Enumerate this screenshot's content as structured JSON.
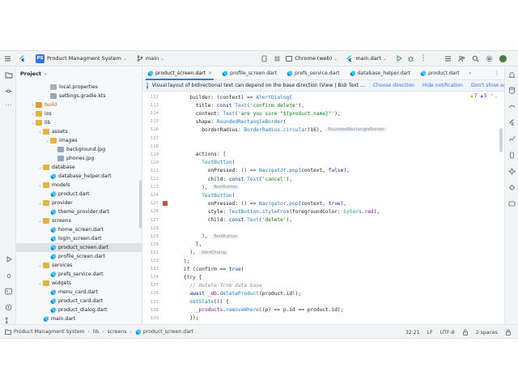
{
  "titlebar": {
    "project_badge": "PS",
    "project_name": "Product Managment System",
    "branch": "main",
    "device": "Chrome (web)",
    "run_config": "main.dart"
  },
  "project_panel": {
    "title": "Project",
    "tree": [
      {
        "label": "local.properties",
        "depth": 3,
        "kind": "prop",
        "expanded": null,
        "selected": false
      },
      {
        "label": "settings.gradle.kts",
        "depth": 3,
        "kind": "kts",
        "expanded": null,
        "selected": false
      },
      {
        "label": "build",
        "depth": 1,
        "kind": "folder-orange",
        "expanded": false,
        "selected": false
      },
      {
        "label": "ios",
        "depth": 1,
        "kind": "folder",
        "expanded": false,
        "selected": false
      },
      {
        "label": "lib",
        "depth": 1,
        "kind": "folder",
        "expanded": true,
        "selected": false
      },
      {
        "label": "assets",
        "depth": 2,
        "kind": "folder",
        "expanded": true,
        "selected": false
      },
      {
        "label": "images",
        "depth": 3,
        "kind": "folder",
        "expanded": true,
        "selected": false
      },
      {
        "label": "background.jpg",
        "depth": 4,
        "kind": "img",
        "expanded": null,
        "selected": false
      },
      {
        "label": "phones.jpg",
        "depth": 4,
        "kind": "img",
        "expanded": null,
        "selected": false
      },
      {
        "label": "database",
        "depth": 2,
        "kind": "folder",
        "expanded": true,
        "selected": false
      },
      {
        "label": "database_helper.dart",
        "depth": 3,
        "kind": "dart",
        "expanded": null,
        "selected": false
      },
      {
        "label": "models",
        "depth": 2,
        "kind": "folder",
        "expanded": true,
        "selected": false
      },
      {
        "label": "product.dart",
        "depth": 3,
        "kind": "dart",
        "expanded": null,
        "selected": false
      },
      {
        "label": "provider",
        "depth": 2,
        "kind": "folder",
        "expanded": true,
        "selected": false
      },
      {
        "label": "theme_provider.dart",
        "depth": 3,
        "kind": "dart",
        "expanded": null,
        "selected": false
      },
      {
        "label": "screens",
        "depth": 2,
        "kind": "folder",
        "expanded": true,
        "selected": false
      },
      {
        "label": "home_screen.dart",
        "depth": 3,
        "kind": "dart",
        "expanded": null,
        "selected": false
      },
      {
        "label": "login_screen.dart",
        "depth": 3,
        "kind": "dart",
        "expanded": null,
        "selected": false
      },
      {
        "label": "product_screen.dart",
        "depth": 3,
        "kind": "dart",
        "expanded": null,
        "selected": true
      },
      {
        "label": "profile_screen.dart",
        "depth": 3,
        "kind": "dart",
        "expanded": null,
        "selected": false
      },
      {
        "label": "services",
        "depth": 2,
        "kind": "folder",
        "expanded": true,
        "selected": false
      },
      {
        "label": "prefs_service.dart",
        "depth": 3,
        "kind": "dart",
        "expanded": null,
        "selected": false
      },
      {
        "label": "widgets",
        "depth": 2,
        "kind": "folder",
        "expanded": true,
        "selected": false
      },
      {
        "label": "menu_card.dart",
        "depth": 3,
        "kind": "dart",
        "expanded": null,
        "selected": false
      },
      {
        "label": "product_card.dart",
        "depth": 3,
        "kind": "dart",
        "expanded": null,
        "selected": false
      },
      {
        "label": "product_dialog.dart",
        "depth": 3,
        "kind": "dart",
        "expanded": null,
        "selected": false
      },
      {
        "label": "main.dart",
        "depth": 2,
        "kind": "dart",
        "expanded": null,
        "selected": false
      }
    ]
  },
  "editor": {
    "tabs": [
      {
        "label": "product_screen.dart",
        "active": true,
        "closable": true
      },
      {
        "label": "profile_screen.dart",
        "active": false,
        "closable": false
      },
      {
        "label": "prefs_service.dart",
        "active": false,
        "closable": false
      },
      {
        "label": "database_helper.dart",
        "active": false,
        "closable": false
      },
      {
        "label": "product.dart",
        "active": false,
        "closable": false
      }
    ],
    "banner": {
      "message": "Visual layout of bidirectional text can depend on the base direction (View | Bidi Text ...",
      "choose_direction": "Choose direction",
      "hide_notification": "Hide notification",
      "dont_show_again": "Don't show again"
    },
    "inspections": {
      "warnings": "7",
      "weak_warnings": "5"
    },
    "lines": [
      {
        "n": "112",
        "tokens": [
          [
            "t",
            "      builder: (context) => "
          ],
          [
            "cl",
            "AlertDialog"
          ],
          [
            "t",
            "("
          ]
        ]
      },
      {
        "n": "113",
        "tokens": [
          [
            "t",
            "        title: "
          ],
          [
            "k",
            "const "
          ],
          [
            "cl",
            "Text"
          ],
          [
            "t",
            "("
          ],
          [
            "s",
            "'confirm delete'"
          ],
          [
            "t",
            "),"
          ]
        ]
      },
      {
        "n": "114",
        "tokens": [
          [
            "t",
            "        content: "
          ],
          [
            "cl",
            "Text"
          ],
          [
            "t",
            "("
          ],
          [
            "s",
            "'are you sure \"${product.name}\"'"
          ],
          [
            "t",
            "),"
          ]
        ]
      },
      {
        "n": "115",
        "tokens": [
          [
            "t",
            "        shape: "
          ],
          [
            "cl",
            "RoundedRectangleBorder"
          ],
          [
            "t",
            "("
          ]
        ]
      },
      {
        "n": "116",
        "tokens": [
          [
            "t",
            "          borderRadius: "
          ],
          [
            "cl",
            "BorderRadius"
          ],
          [
            "t",
            "."
          ],
          [
            "cl",
            "circular"
          ],
          [
            "t",
            "(16),"
          ]
        ],
        "hint": "RoundedRectangleBorder"
      },
      {
        "n": "117",
        "tokens": [
          [
            "t",
            ""
          ]
        ]
      },
      {
        "n": "118",
        "tokens": [
          [
            "t",
            ""
          ]
        ]
      },
      {
        "n": "119",
        "tokens": [
          [
            "t",
            "        actions: ["
          ]
        ]
      },
      {
        "n": "120",
        "tokens": [
          [
            "t",
            "          "
          ],
          [
            "cl",
            "TextButton"
          ],
          [
            "t",
            "("
          ]
        ]
      },
      {
        "n": "121",
        "tokens": [
          [
            "t",
            "            onPressed: () => "
          ],
          [
            "cl",
            "Navigator"
          ],
          [
            "t",
            "."
          ],
          [
            "cl",
            "pop"
          ],
          [
            "t",
            "(context, "
          ],
          [
            "k",
            "false"
          ],
          [
            "t",
            "),"
          ]
        ]
      },
      {
        "n": "122",
        "tokens": [
          [
            "t",
            "            child: "
          ],
          [
            "k",
            "const "
          ],
          [
            "cl",
            "Text"
          ],
          [
            "t",
            "("
          ],
          [
            "s",
            "'cancel'"
          ],
          [
            "t",
            "),"
          ]
        ]
      },
      {
        "n": "123",
        "tokens": [
          [
            "t",
            "          ),"
          ]
        ],
        "hint": "TextButton"
      },
      {
        "n": "124",
        "tokens": [
          [
            "t",
            "          "
          ],
          [
            "cl",
            "TextButton"
          ],
          [
            "t",
            "("
          ]
        ]
      },
      {
        "n": "125",
        "tokens": [
          [
            "t",
            "            onPressed: () => "
          ],
          [
            "cl",
            "Navigator"
          ],
          [
            "t",
            "."
          ],
          [
            "cl",
            "pop"
          ],
          [
            "t",
            "(context, "
          ],
          [
            "k",
            "true"
          ],
          [
            "t",
            "),"
          ]
        ],
        "breakpoint": true
      },
      {
        "n": "126",
        "tokens": [
          [
            "t",
            "            style: "
          ],
          [
            "cl",
            "TextButton"
          ],
          [
            "t",
            "."
          ],
          [
            "cl",
            "styleFrom"
          ],
          [
            "t",
            "(foregroundColor: "
          ],
          [
            "cl",
            "Colors"
          ],
          [
            "t",
            "."
          ],
          [
            "p",
            "red"
          ],
          [
            "t",
            "),"
          ]
        ]
      },
      {
        "n": "127",
        "tokens": [
          [
            "t",
            "            child: "
          ],
          [
            "k",
            "const "
          ],
          [
            "cl",
            "Text"
          ],
          [
            "t",
            "("
          ],
          [
            "s",
            "'delete'"
          ],
          [
            "t",
            "),"
          ]
        ]
      },
      {
        "n": "128",
        "tokens": [
          [
            "t",
            ""
          ]
        ]
      },
      {
        "n": "129",
        "tokens": [
          [
            "t",
            "          ),"
          ]
        ],
        "hint": "TextButton"
      },
      {
        "n": "130",
        "tokens": [
          [
            "t",
            "        ],"
          ]
        ]
      },
      {
        "n": "131",
        "tokens": [
          [
            "t",
            "      ),"
          ]
        ],
        "hint": "AlertDialog"
      },
      {
        "n": "132",
        "tokens": [
          [
            "t",
            "    );"
          ]
        ]
      },
      {
        "n": "133",
        "tokens": [
          [
            "t",
            "    "
          ],
          [
            "k",
            "if "
          ],
          [
            "t",
            "(confirm == "
          ],
          [
            "k",
            "true"
          ],
          [
            "t",
            ")"
          ]
        ]
      },
      {
        "n": "134",
        "tokens": [
          [
            "t",
            "    {"
          ],
          [
            "k",
            "try "
          ],
          [
            "t",
            "{"
          ]
        ]
      },
      {
        "n": "135",
        "tokens": [
          [
            "c",
            "      // delete from data base"
          ]
        ]
      },
      {
        "n": "136",
        "tokens": [
          [
            "t",
            "      "
          ],
          [
            "k",
            "await "
          ],
          [
            "p",
            "_db"
          ],
          [
            "t",
            "."
          ],
          [
            "cl",
            "deleteProduct"
          ],
          [
            "t",
            "(product.id!);"
          ]
        ]
      },
      {
        "n": "137",
        "tokens": [
          [
            "t",
            "      "
          ],
          [
            "cl",
            "setState"
          ],
          [
            "t",
            "(() {"
          ]
        ]
      },
      {
        "n": "138",
        "tokens": [
          [
            "t",
            "        "
          ],
          [
            "p",
            "_products"
          ],
          [
            "t",
            "."
          ],
          [
            "cl",
            "removeWhere"
          ],
          [
            "t",
            "((p) => p.id == product.id);"
          ]
        ]
      },
      {
        "n": "139",
        "tokens": [
          [
            "t",
            "      });"
          ]
        ]
      }
    ]
  },
  "statusbar": {
    "breadcrumbs": [
      "Product Managment System",
      "lib",
      "screens",
      "product_screen.dart"
    ],
    "position": "32:21",
    "line_ending": "LF",
    "encoding": "UTF-8",
    "indent": "2 spaces"
  }
}
